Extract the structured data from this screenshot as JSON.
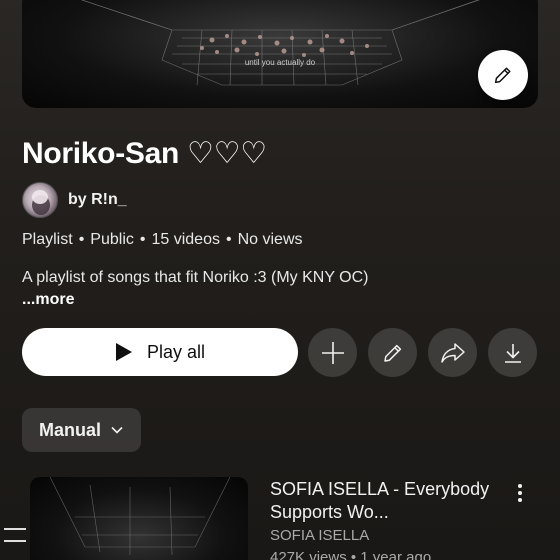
{
  "cover": {
    "caption": "until you actually do"
  },
  "playlist": {
    "title": "Noriko-San ♡♡♡",
    "owner": "by R!n_",
    "type": "Playlist",
    "visibility": "Public",
    "video_count": "15 videos",
    "views": "No views",
    "description": "A playlist of songs that fit Noriko :3 (My KNY OC)",
    "more_label": "...more"
  },
  "actions": {
    "play_all_label": "Play all"
  },
  "sort": {
    "selected": "Manual"
  },
  "videos": [
    {
      "title": "SOFIA ISELLA - Everybody Supports Wo...",
      "channel": "SOFIA ISELLA",
      "stats": "427K views • 1 year ago"
    }
  ],
  "icons": {
    "edit": "pencil-icon",
    "add": "plus-icon",
    "share": "share-icon",
    "download": "download-icon",
    "play": "play-icon",
    "sort_toggle": "chevron-down-icon",
    "more": "more-vert-icon",
    "reorder": "drag-handle-icon"
  },
  "colors": {
    "background": "#1c1a18",
    "primary_button": "#ffffff",
    "secondary_button": "rgba(255,255,255,0.14)",
    "text_secondary": "#aaaaaa"
  }
}
